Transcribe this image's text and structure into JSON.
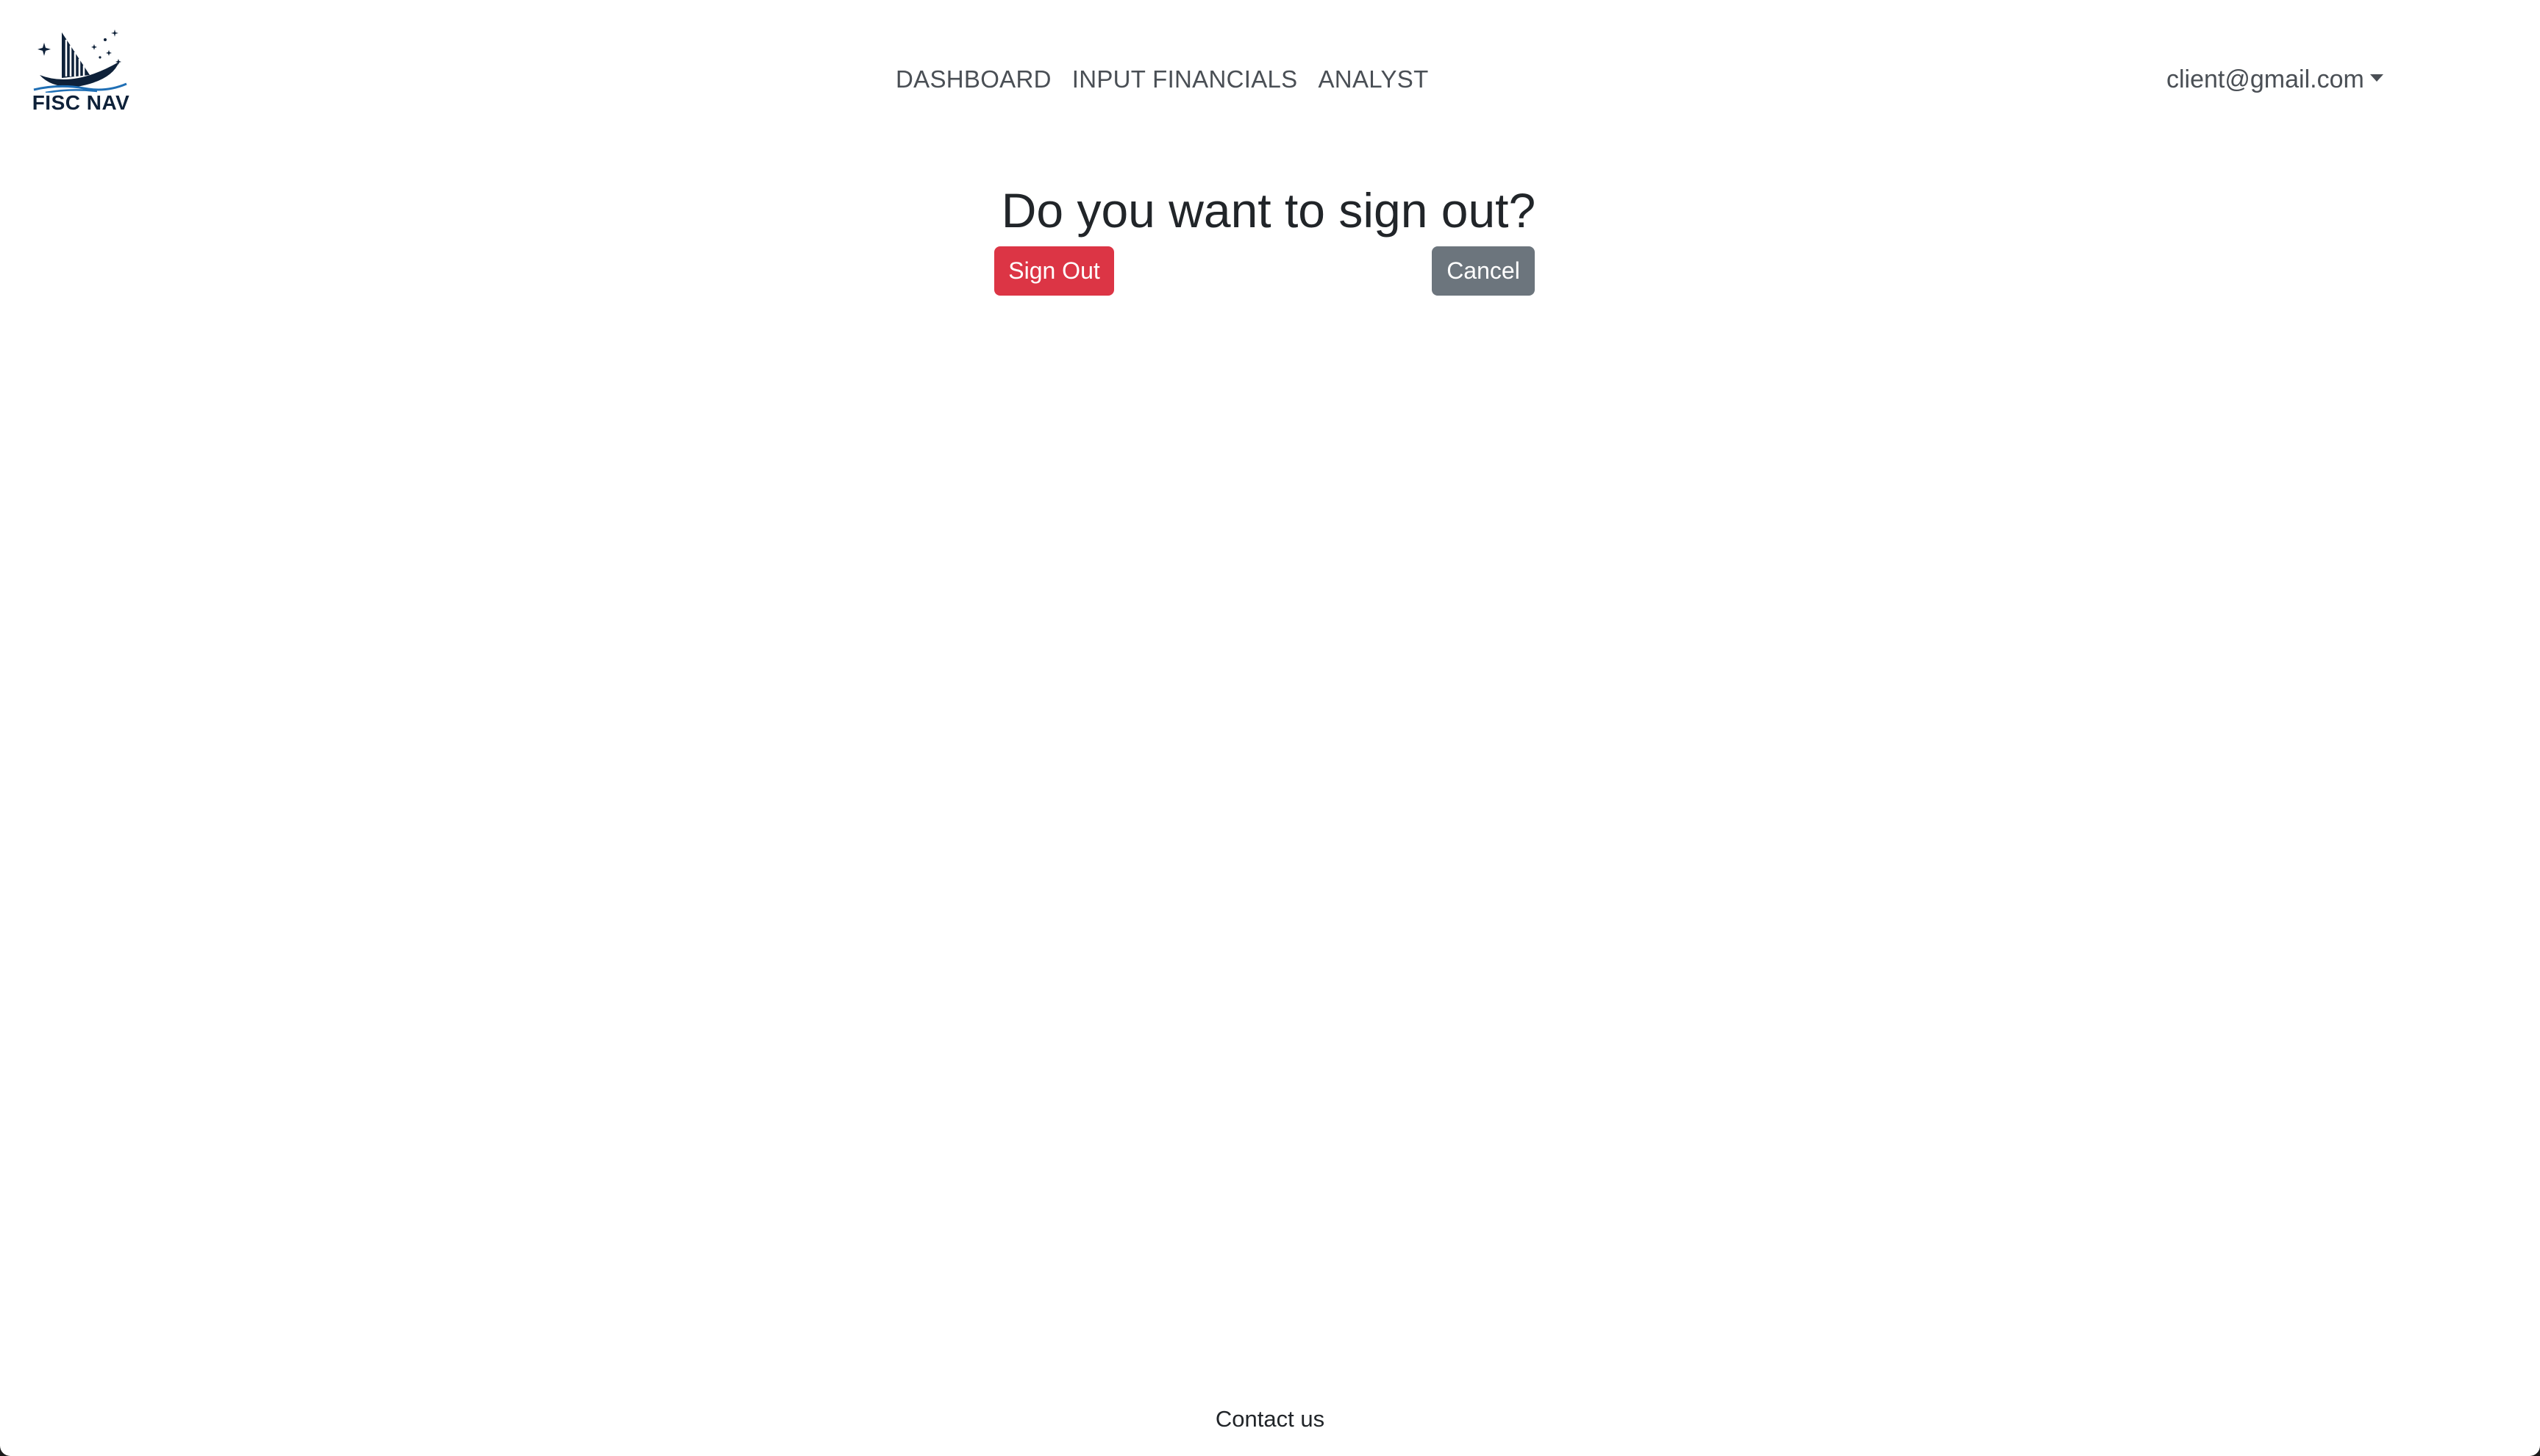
{
  "brand": {
    "name": "FISC NAV",
    "logo_icon": "sailboat-stars-logo"
  },
  "nav": {
    "links": [
      {
        "label": "DASHBOARD"
      },
      {
        "label": "INPUT FINANCIALS"
      },
      {
        "label": "ANALYST"
      }
    ]
  },
  "user_menu": {
    "email": "client@gmail.com",
    "caret_icon": "caret-down-icon"
  },
  "main": {
    "title": "Do you want to sign out?",
    "sign_out_label": "Sign Out",
    "cancel_label": "Cancel"
  },
  "footer": {
    "contact_label": "Contact us"
  },
  "colors": {
    "danger": "#dc3545",
    "secondary": "#6c757d",
    "nav_text": "#4a4f55",
    "brand_navy": "#0e2139"
  }
}
